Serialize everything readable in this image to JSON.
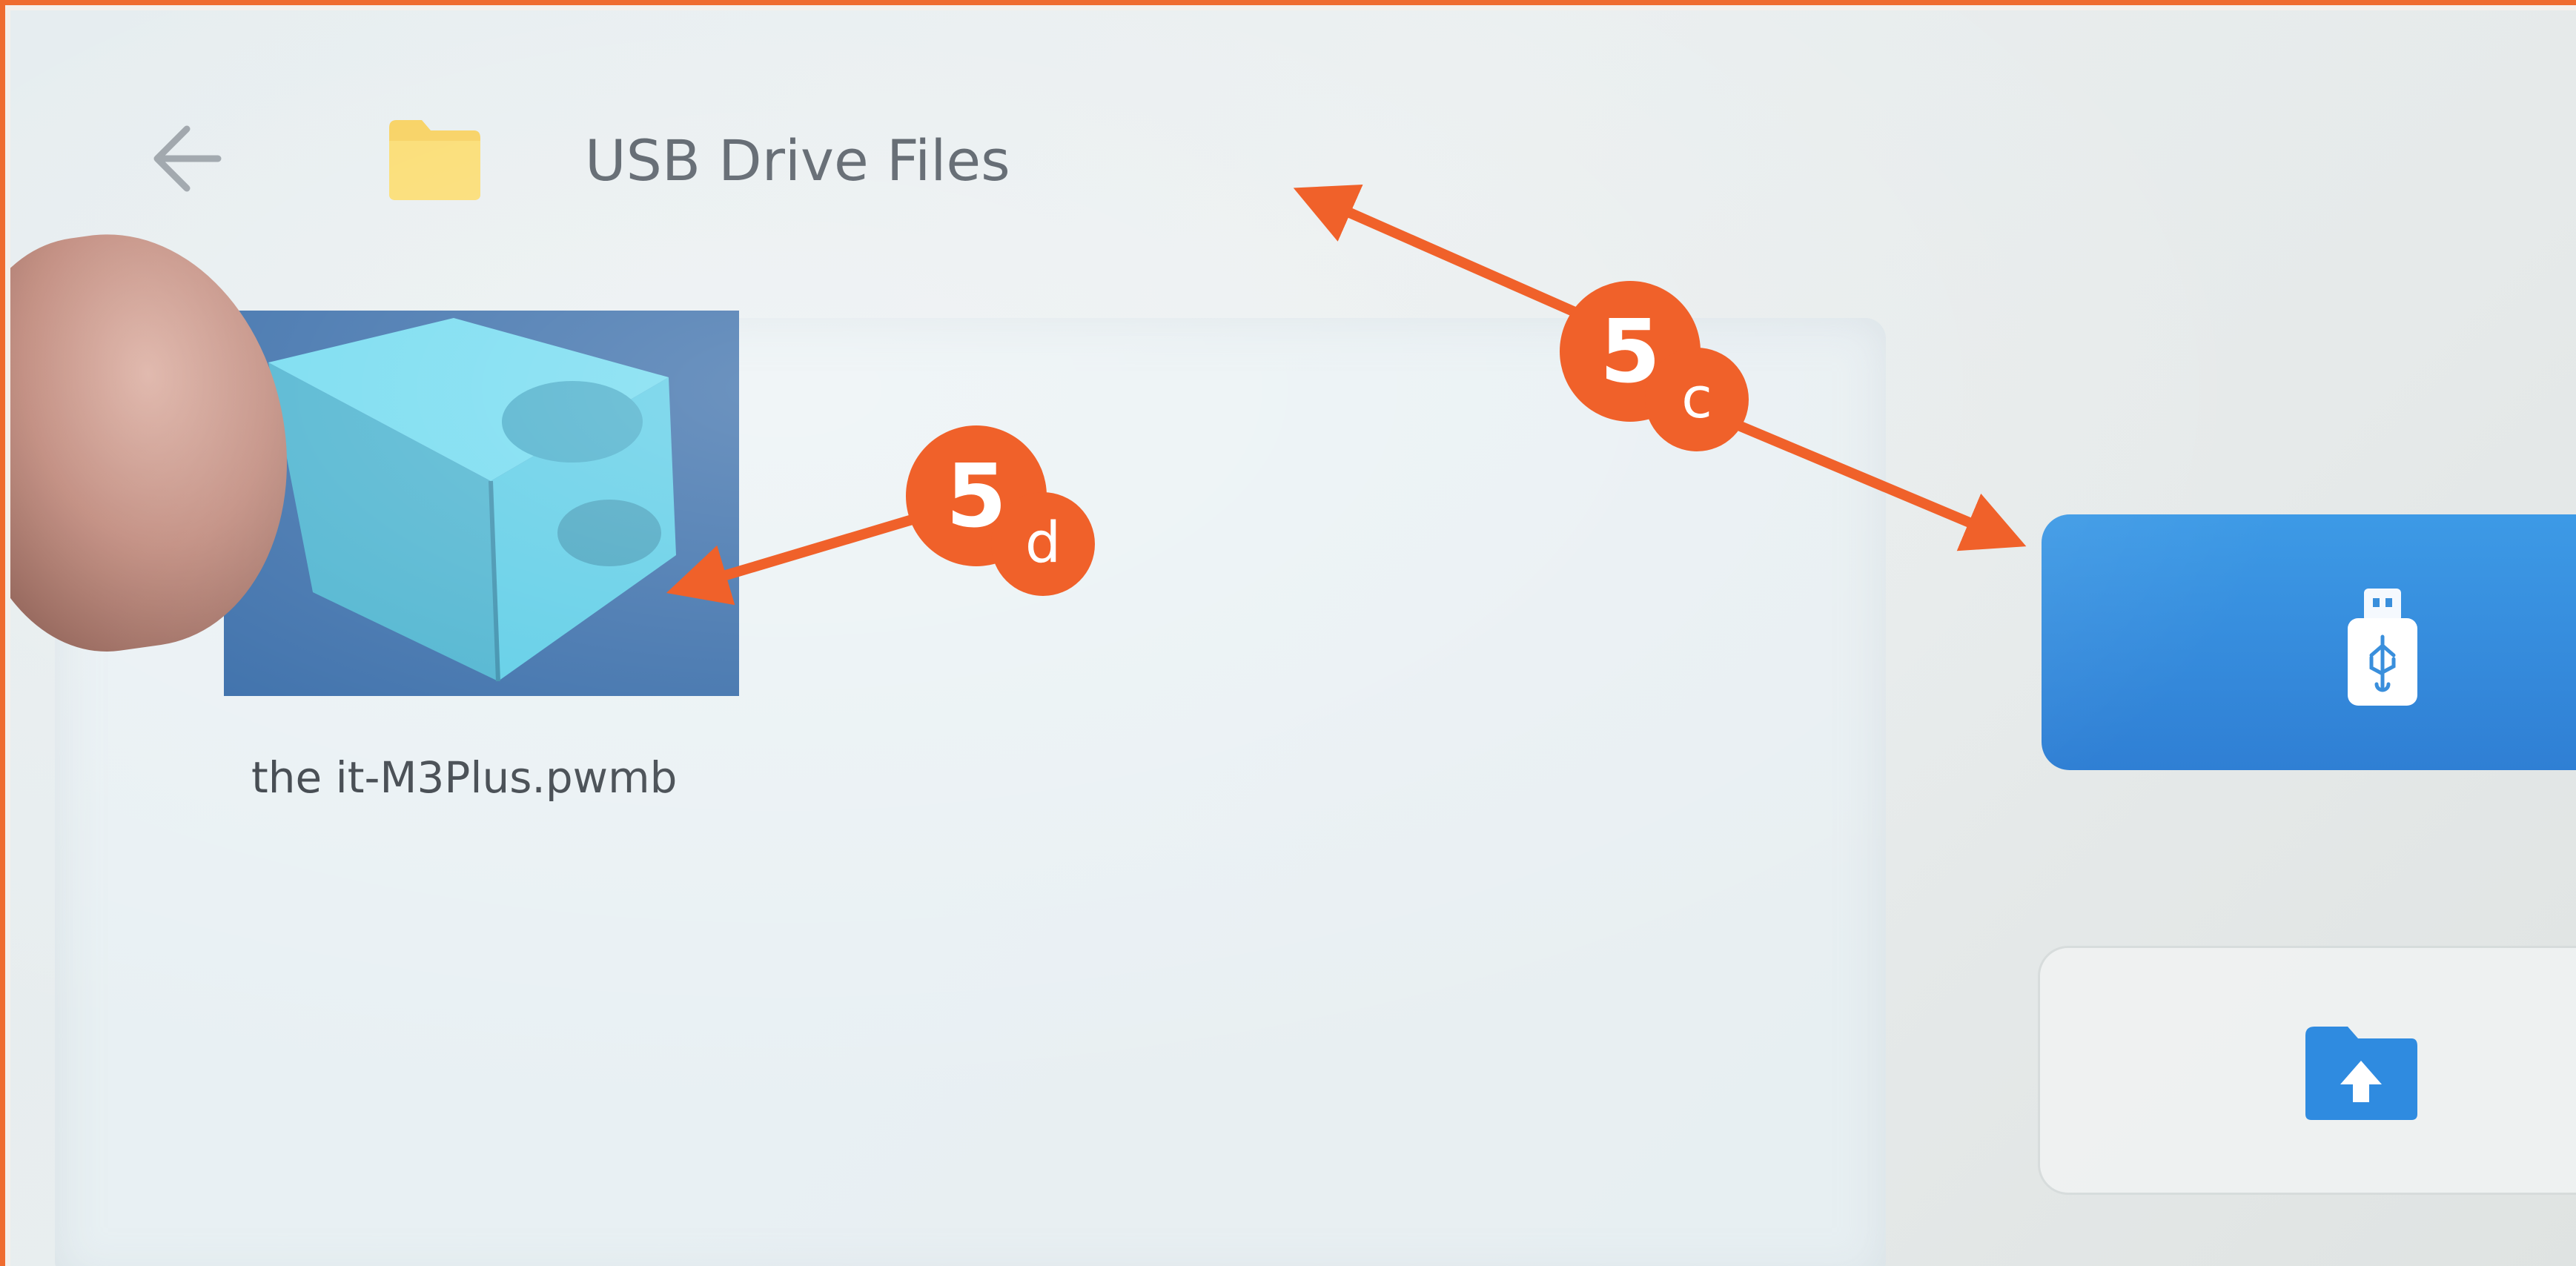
{
  "header": {
    "title": "USB Drive Files",
    "back_icon": "arrow-left-icon",
    "folder_icon": "folder-icon"
  },
  "files": [
    {
      "name": "the it-M3Plus.pwmb",
      "thumbnail_icon": "3d-model-thumbnail"
    }
  ],
  "side_buttons": [
    {
      "icon": "usb-drive-icon",
      "state": "selected"
    },
    {
      "icon": "upload-folder-icon",
      "state": "normal"
    }
  ],
  "annotations": [
    {
      "number": "5",
      "letter": "c"
    },
    {
      "number": "5",
      "letter": "d"
    }
  ],
  "colors": {
    "accent_orange": "#f0612a",
    "usb_button_blue": "#3d9ae6",
    "folder_yellow": "#f6c944",
    "thumbnail_bg": "#1f5a9e",
    "model_cyan": "#3cbfdc"
  }
}
